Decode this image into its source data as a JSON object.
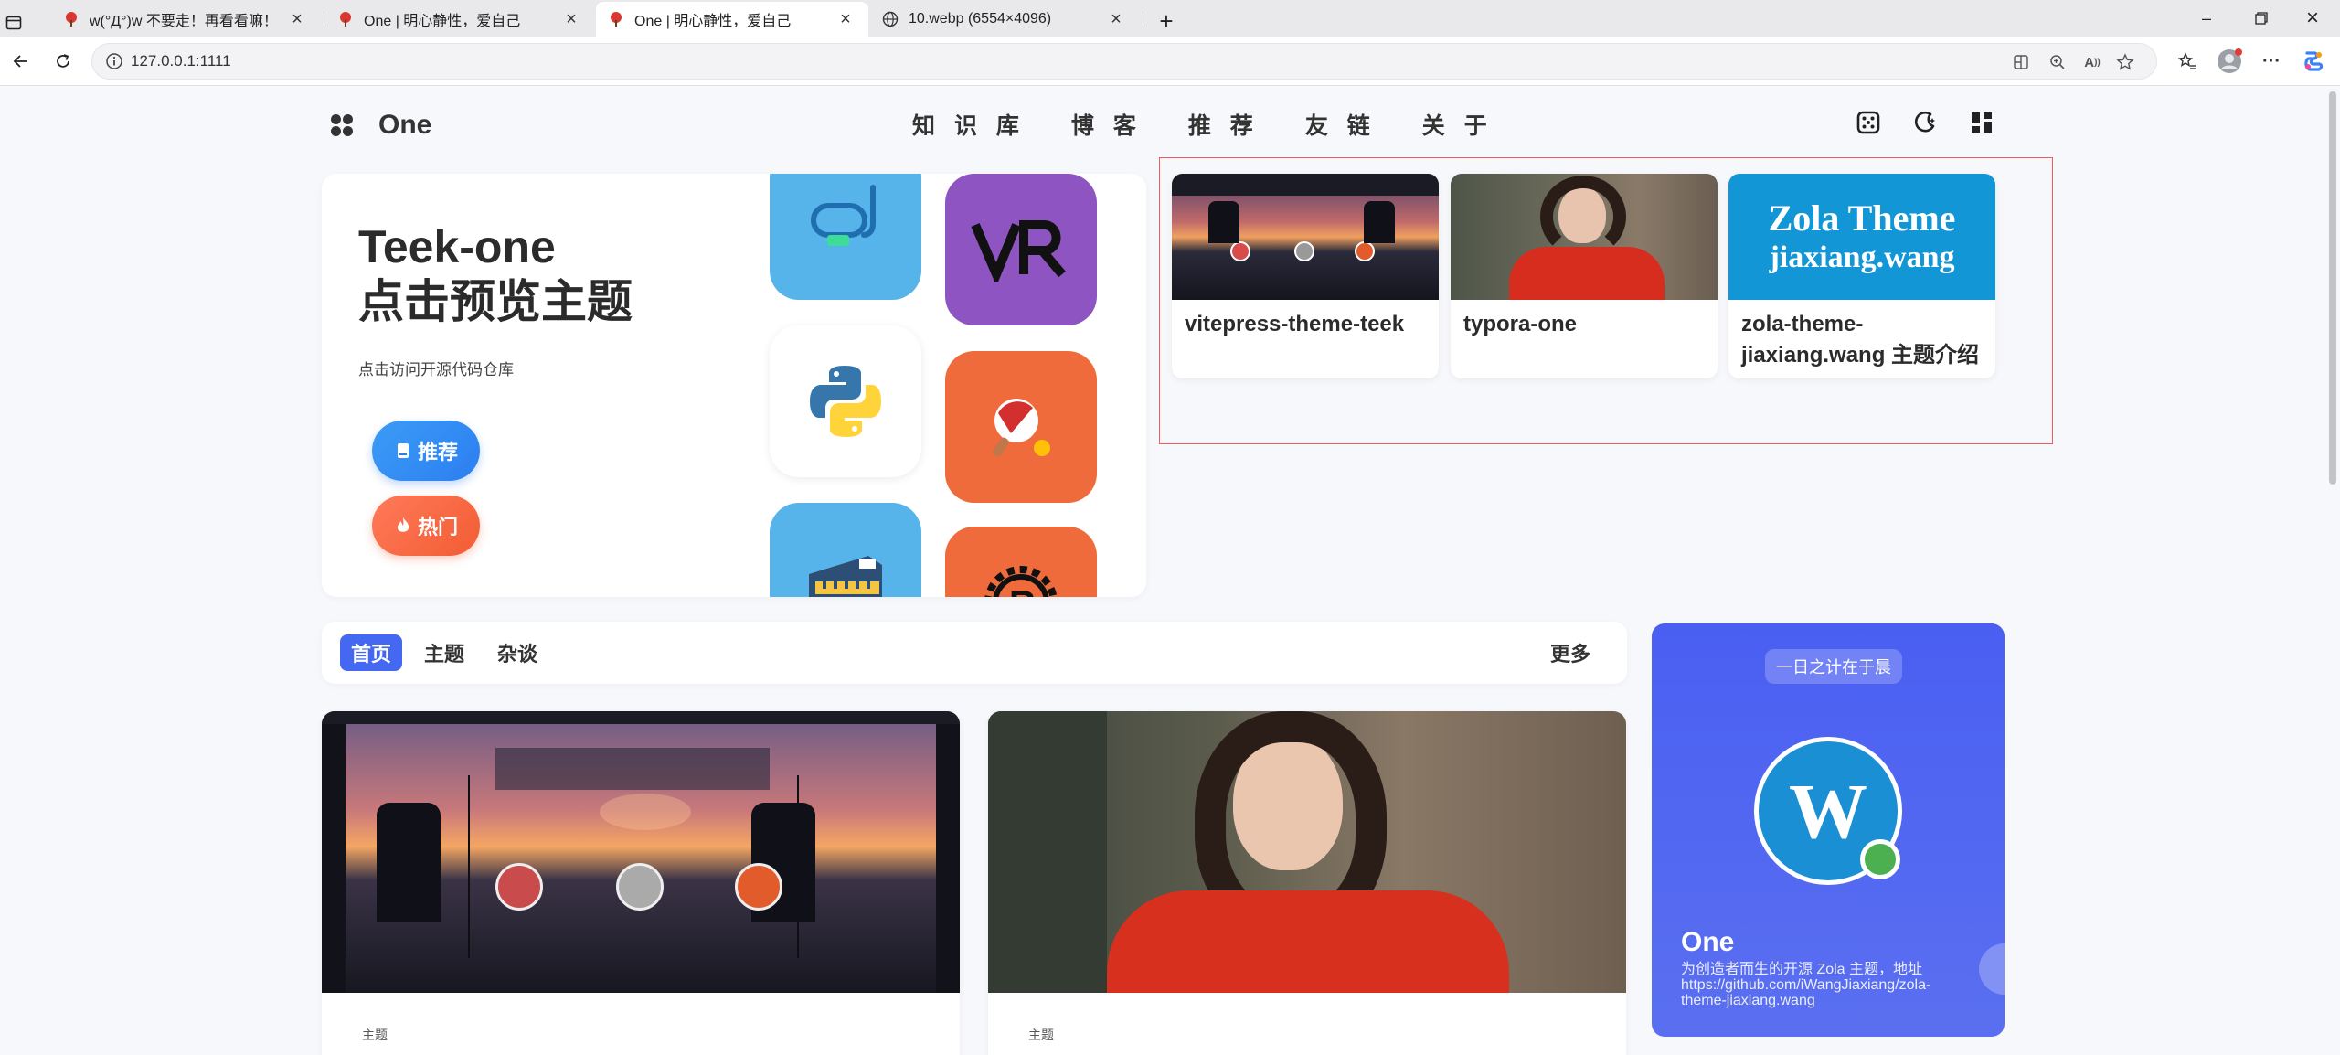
{
  "browser": {
    "tabs": [
      {
        "title": "w(°Д°)w 不要走！再看看嘛！"
      },
      {
        "title": "One | 明心静性，爱自己"
      },
      {
        "title": "One | 明心静性，爱自己"
      },
      {
        "title": "10.webp (6554×4096)"
      }
    ],
    "url": "127.0.0.1:1111"
  },
  "site": {
    "logo": "One",
    "nav": [
      "知 识 库",
      "博 客",
      "推 荐",
      "友 链",
      "关 于"
    ]
  },
  "hero": {
    "title_line1": "Teek-one",
    "title_line2": "点击预览主题",
    "subtitle": "点击访问开源代码仓库",
    "btn_recommend": "推荐",
    "btn_hot": "热门"
  },
  "featured": [
    {
      "name": "vitepress-theme-teek"
    },
    {
      "name": "typora-one"
    },
    {
      "name": "zola-theme-jiaxiang.wang 主题介绍",
      "thumb_line1": "Zola Theme",
      "thumb_line2": "jiaxiang.wang"
    }
  ],
  "content_tabs": {
    "items": [
      "首页",
      "主题",
      "杂谈"
    ],
    "more": "更多"
  },
  "posts": [
    {
      "category": "主题"
    },
    {
      "category": "主题"
    }
  ],
  "profile": {
    "quote": "一日之计在于晨",
    "avatar_letter": "W",
    "name": "One",
    "desc_line1": "为创造者而生的开源 Zola 主题，地址",
    "desc_line2": "https://github.com/iWangJiaxiang/zola-",
    "desc_line3": "theme-jiaxiang.wang"
  },
  "colors": {
    "accent": "#4568f2",
    "recommend": "#2c7ef0",
    "hot": "#f25c33",
    "highlight_border": "#f05a5a"
  }
}
